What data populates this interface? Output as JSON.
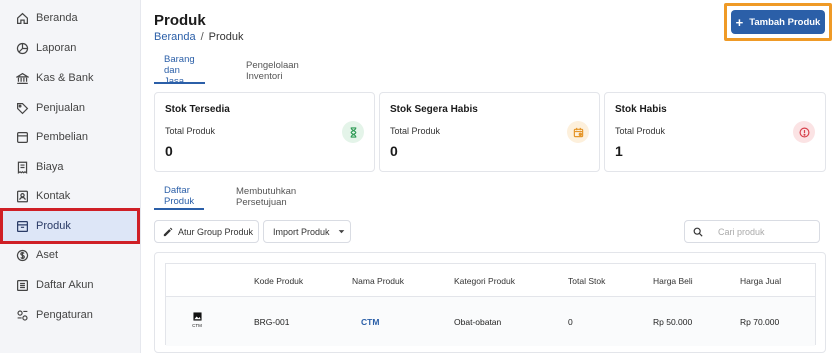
{
  "sidebar": {
    "items": [
      {
        "label": "Beranda",
        "icon": "home-icon"
      },
      {
        "label": "Laporan",
        "icon": "pie-chart-icon"
      },
      {
        "label": "Kas & Bank",
        "icon": "bank-icon"
      },
      {
        "label": "Penjualan",
        "icon": "tag-icon"
      },
      {
        "label": "Pembelian",
        "icon": "cart-icon"
      },
      {
        "label": "Biaya",
        "icon": "receipt-icon"
      },
      {
        "label": "Kontak",
        "icon": "contact-icon"
      },
      {
        "label": "Produk",
        "icon": "box-icon",
        "active": true
      },
      {
        "label": "Aset",
        "icon": "dollar-icon"
      },
      {
        "label": "Daftar Akun",
        "icon": "list-icon"
      },
      {
        "label": "Pengaturan",
        "icon": "settings-icon"
      }
    ]
  },
  "header": {
    "title": "Produk",
    "breadcrumb": {
      "home": "Beranda",
      "separator": "/",
      "current": "Produk"
    },
    "add_button": "Tambah Produk"
  },
  "tabs_top": [
    "Barang dan Jasa",
    "Pengelolaan Inventori"
  ],
  "cards": [
    {
      "title": "Stok Tersedia",
      "subtitle": "Total Produk",
      "value": "0",
      "icon": "hourglass-icon",
      "icon_color": "#2e9a55",
      "icon_bg": "#e4f4e9"
    },
    {
      "title": "Stok Segera Habis",
      "subtitle": "Total Produk",
      "value": "0",
      "icon": "calendar-icon",
      "icon_color": "#e5962a",
      "icon_bg": "#fdf0dc"
    },
    {
      "title": "Stok Habis",
      "subtitle": "Total Produk",
      "value": "1",
      "icon": "alert-icon",
      "icon_color": "#d6404a",
      "icon_bg": "#fbe3e4"
    }
  ],
  "tabs_sub": [
    "Daftar Produk",
    "Membutuhkan Persetujuan"
  ],
  "toolbar": {
    "group_button": "Atur Group Produk",
    "import_button": "Import Produk",
    "search_placeholder": "Cari produk"
  },
  "table": {
    "columns": [
      "Kode Produk",
      "Nama Produk",
      "Kategori Produk",
      "Total Stok",
      "Harga Beli",
      "Harga Jual"
    ],
    "rows": [
      {
        "thumb_caption": "CTM",
        "kode": "BRG-001",
        "nama": "CTM",
        "kategori": "Obat-obatan",
        "stok": "0",
        "harga_beli": "Rp 50.000",
        "harga_jual": "Rp 70.000"
      }
    ]
  },
  "colors": {
    "accent": "#2b5fa8",
    "highlight_red": "#cf1f26",
    "highlight_orange": "#ef9a26"
  }
}
